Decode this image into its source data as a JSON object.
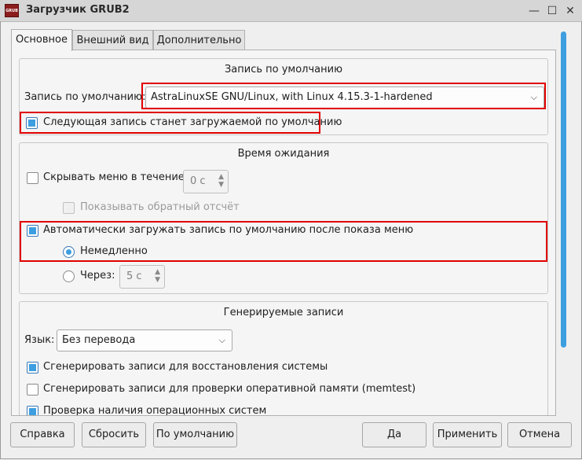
{
  "window": {
    "icon_text": "GRUB",
    "title": "Загрузчик GRUB2",
    "minimize_glyph": "—",
    "maximize_glyph": "☐",
    "close_glyph": "✕"
  },
  "tabs": [
    {
      "label": "Основное",
      "active": true
    },
    {
      "label": "Внешний вид",
      "active": false
    },
    {
      "label": "Дополнительно",
      "active": false
    }
  ],
  "default_entry": {
    "group_title": "Запись по умолчанию",
    "label": "Запись по умолчанию:",
    "combo_value": "AstraLinuxSE GNU/Linux, with Linux 4.15.3-1-hardened",
    "next_entry_checkbox": {
      "label": "Следующая запись станет загружаемой по умолчанию",
      "checked": true
    }
  },
  "timeout": {
    "group_title": "Время ожидания",
    "hide_menu": {
      "label": "Скрывать меню в течение:",
      "checked": false,
      "spin_value": "0 с"
    },
    "countdown": {
      "label": "Показывать обратный отсчёт",
      "checked": false,
      "disabled": true
    },
    "auto_boot": {
      "label": "Автоматически загружать запись по умолчанию после показа меню",
      "checked": true
    },
    "immediately": {
      "label": "Немедленно",
      "selected": true
    },
    "after": {
      "label": "Через:",
      "selected": false,
      "spin_value": "5 с"
    }
  },
  "generated": {
    "group_title": "Генерируемые записи",
    "language_label": "Язык:",
    "language_value": "Без перевода",
    "recovery": {
      "label": "Сгенерировать записи для восстановления системы",
      "checked": true
    },
    "memtest": {
      "label": "Сгенерировать записи для проверки оперативной памяти (memtest)",
      "checked": false
    },
    "os_prober": {
      "label": "Проверка наличия операционных систем",
      "checked": true
    }
  },
  "buttons": {
    "help": "Справка",
    "reset": "Сбросить",
    "defaults": "По умолчанию",
    "ok": "Да",
    "apply": "Применить",
    "cancel": "Отмена"
  },
  "icons": {
    "combo_arrow": "chevron-down-icon",
    "spin_arrows": "spin-up-down-icon"
  },
  "colors": {
    "accent": "#3d9ee0",
    "highlight": "#e00000"
  }
}
